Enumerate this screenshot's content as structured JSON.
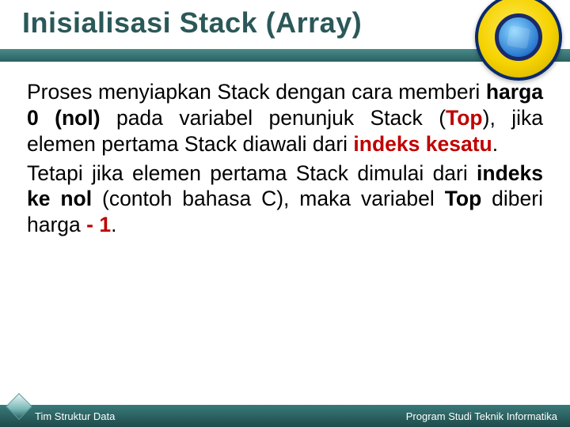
{
  "header": {
    "title": "Inisialisasi Stack (Array)"
  },
  "content": {
    "p1_t1": "Proses menyiapkan Stack dengan cara memberi ",
    "p1_b1": "harga 0 (nol)",
    "p1_t2": " pada variabel penunjuk Stack (",
    "p1_r1": "Top",
    "p1_t3": "), jika elemen pertama Stack diawali dari ",
    "p1_r2": "indeks kesatu",
    "p1_t4": ".",
    "p2_t1": "Tetapi jika elemen pertama Stack dimulai dari ",
    "p2_b1": "indeks ke nol",
    "p2_t2": " (contoh bahasa C), maka variabel ",
    "p2_b2": "Top",
    "p2_t3": " diberi harga ",
    "p2_r1": "- 1",
    "p2_t4": "."
  },
  "footer": {
    "left": "Tim Struktur Data",
    "right": "Program Studi Teknik Informatika"
  }
}
